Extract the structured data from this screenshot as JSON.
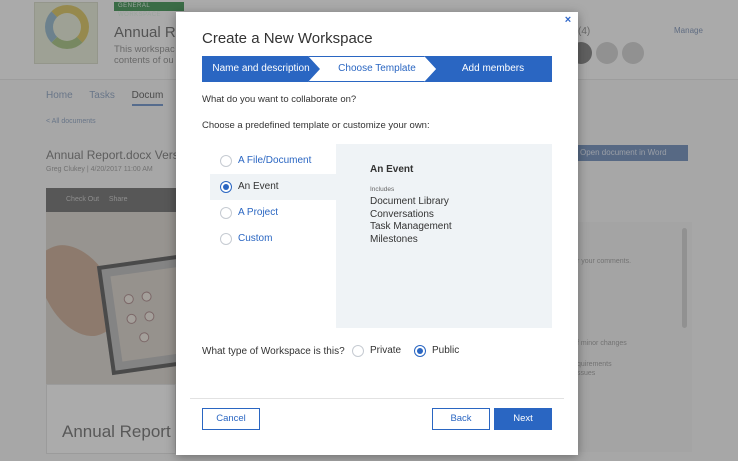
{
  "background": {
    "badge": "GENERAL WORKSPACE",
    "workspace_title": "Annual Rep",
    "workspace_desc_line1": "This workspac",
    "workspace_desc_line2": "contents of ou",
    "members_count": "(4)",
    "manage_link": "Manage",
    "tabs": [
      "Home",
      "Tasks",
      "Docum"
    ],
    "all_documents": "< All documents",
    "doc_title": "Annual Report.docx Vers",
    "doc_meta": "Greg Clukey | 4/20/2017 11:00 AM",
    "viewer_checkout": "Check Out",
    "viewer_share": "Share",
    "paper_title": "Annual Report",
    "open_in_word": "Open document in Word",
    "side_text1": "r your comments.",
    "side_text2": "f minor changes",
    "side_text3a": "quirements",
    "side_text3b": "ssues"
  },
  "modal": {
    "close_glyph": "×",
    "title": "Create a New Workspace",
    "steps": [
      "Name and description",
      "Choose Template",
      "Add members"
    ],
    "active_step_index": 1,
    "question_collaborate": "What do you want to collaborate on?",
    "question_template": "Choose a predefined template or customize your own:",
    "template_options": [
      {
        "label": "A File/Document",
        "selected": false
      },
      {
        "label": "An Event",
        "selected": true
      },
      {
        "label": "A Project",
        "selected": false
      },
      {
        "label": "Custom",
        "selected": false
      }
    ],
    "preview": {
      "title": "An Event",
      "includes_label": "Includes",
      "items": [
        "Document Library",
        "Conversations",
        "Task Management",
        "Milestones"
      ]
    },
    "question_type": "What type of Workspace is this?",
    "visibility_options": [
      {
        "label": "Private",
        "selected": false
      },
      {
        "label": "Public",
        "selected": true
      }
    ],
    "buttons": {
      "cancel": "Cancel",
      "back": "Back",
      "next": "Next"
    }
  },
  "colors": {
    "accent": "#2a66c2",
    "preview_bg": "#eff3f6"
  }
}
